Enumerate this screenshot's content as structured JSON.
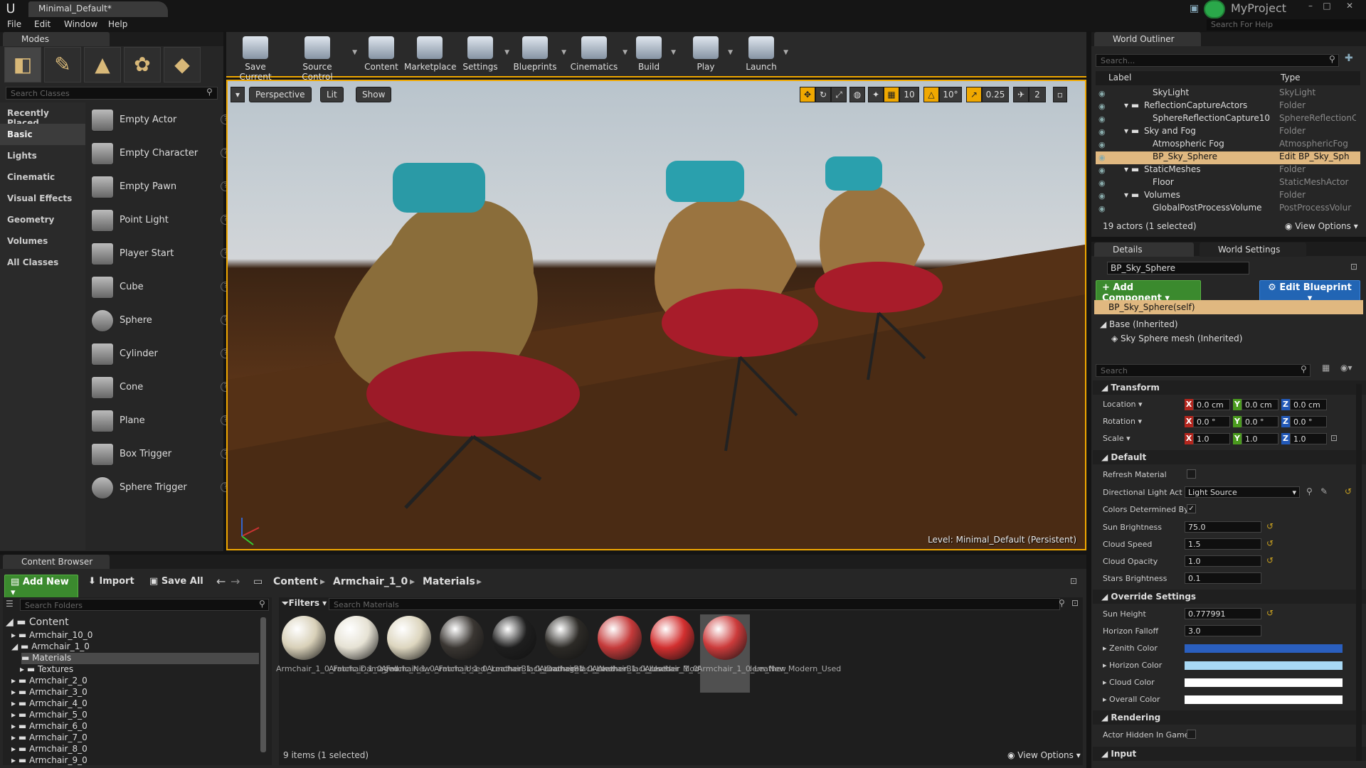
{
  "window": {
    "tab_title": "Minimal_Default",
    "project_name": "MyProject",
    "help_search_placeholder": "Search For Help"
  },
  "menu": [
    "File",
    "Edit",
    "Window",
    "Help"
  ],
  "modes": {
    "tab_label": "Modes",
    "search_placeholder": "Search Classes",
    "categories": [
      "Recently Placed",
      "Basic",
      "Lights",
      "Cinematic",
      "Visual Effects",
      "Geometry",
      "Volumes",
      "All Classes"
    ],
    "selected_category": "Basic",
    "items": [
      "Empty Actor",
      "Empty Character",
      "Empty Pawn",
      "Point Light",
      "Player Start",
      "Cube",
      "Sphere",
      "Cylinder",
      "Cone",
      "Plane",
      "Box Trigger",
      "Sphere Trigger"
    ]
  },
  "toolbar": {
    "buttons": [
      "Save Current",
      "Source Control",
      "Content",
      "Marketplace",
      "Settings",
      "Blueprints",
      "Cinematics",
      "Build",
      "Play",
      "Launch"
    ]
  },
  "viewport": {
    "perspective": "Perspective",
    "lit": "Lit",
    "show": "Show",
    "grid_snap": "10",
    "rot_snap": "10°",
    "scale_snap": "0.25",
    "camera_speed": "2",
    "level_label": "Level:",
    "level_name": "Minimal_Default (Persistent)"
  },
  "outliner": {
    "tab_label": "World Outliner",
    "search_placeholder": "Search...",
    "col_label": "Label",
    "col_type": "Type",
    "rows": [
      {
        "label": "SkyLight",
        "type": "SkyLight"
      },
      {
        "label": "ReflectionCaptureActors",
        "type": "Folder"
      },
      {
        "label": "SphereReflectionCapture10",
        "type": "SphereReflectionC"
      },
      {
        "label": "Sky and Fog",
        "type": "Folder"
      },
      {
        "label": "Atmospheric Fog",
        "type": "AtmosphericFog"
      },
      {
        "label": "BP_Sky_Sphere",
        "type": "Edit BP_Sky_Sph"
      },
      {
        "label": "StaticMeshes",
        "type": "Folder"
      },
      {
        "label": "Floor",
        "type": "StaticMeshActor"
      },
      {
        "label": "Volumes",
        "type": "Folder"
      },
      {
        "label": "GlobalPostProcessVolume",
        "type": "PostProcessVolur"
      }
    ],
    "footer": "19 actors (1 selected)",
    "view_options": "View Options"
  },
  "details": {
    "tab_label": "Details",
    "tab2_label": "World Settings",
    "actor_name": "BP_Sky_Sphere",
    "add_component": "+ Add Component",
    "edit_blueprint": "Edit Blueprint",
    "self_row": "BP_Sky_Sphere(self)",
    "base_row": "Base (Inherited)",
    "mesh_row": "Sky Sphere mesh (Inherited)",
    "search_placeholder": "Search",
    "sections": {
      "transform": "Transform",
      "default": "Default",
      "override": "Override Settings",
      "rendering": "Rendering",
      "input": "Input"
    },
    "location_label": "Location",
    "rotation_label": "Rotation",
    "scale_label": "Scale",
    "location": [
      "0.0 cm",
      "0.0 cm",
      "0.0 cm"
    ],
    "rotation": [
      "0.0 °",
      "0.0 °",
      "0.0 °"
    ],
    "scale": [
      "1.0",
      "1.0",
      "1.0"
    ],
    "axis_labels": [
      "X",
      "Y",
      "Z"
    ],
    "props": {
      "refresh_material": "Refresh Material",
      "directional_light_actor": "Directional Light Actor",
      "directional_light_value": "Light Source",
      "colors_determined_by": "Colors Determined By",
      "sun_brightness": "Sun Brightness",
      "sun_brightness_value": "75.0",
      "cloud_speed": "Cloud Speed",
      "cloud_speed_value": "1.5",
      "cloud_opacity": "Cloud Opacity",
      "cloud_opacity_value": "1.0",
      "stars_brightness": "Stars Brightness",
      "stars_brightness_value": "0.1",
      "sun_height": "Sun Height",
      "sun_height_value": "0.777991",
      "horizon_falloff": "Horizon Falloff",
      "horizon_falloff_value": "3.0",
      "zenith_color": "Zenith Color",
      "horizon_color": "Horizon Color",
      "cloud_color": "Cloud Color",
      "overall_color": "Overall Color",
      "actor_hidden": "Actor Hidden In Game"
    },
    "colors": {
      "zenith": "#2a5fbf",
      "horizon": "#a8d8f4",
      "cloud": "#ffffff",
      "overall": "#ffffff"
    }
  },
  "content_browser": {
    "tab_label": "Content Browser",
    "add_new": "Add New",
    "import": "Import",
    "save_all": "Save All",
    "breadcrumb": [
      "Content",
      "Armchair_1_0",
      "Materials"
    ],
    "folder_search_placeholder": "Search Folders",
    "filters": "Filters",
    "asset_search_placeholder": "Search Materials",
    "folders": [
      "Content",
      "Armchair_10_0",
      "Armchair_1_0",
      "Materials",
      "Textures",
      "Armchair_2_0",
      "Armchair_3_0",
      "Armchair_4_0",
      "Armchair_5_0",
      "Armchair_6_0",
      "Armchair_7_0",
      "Armchair_8_0",
      "Armchair_9_0"
    ],
    "assets": [
      {
        "name": "Armchair_1_0_Fabric_Damaged",
        "color": "#d8d0b8"
      },
      {
        "name": "Armchair_1_0_Fabric_New",
        "color": "#e6e2d4"
      },
      {
        "name": "Armchair_1_0_Fabric_Used",
        "color": "#ddd6bf"
      },
      {
        "name": "Armchair_1_0_LeatherBlack_Damaged",
        "color": "#3a3632"
      },
      {
        "name": "Armchair_1_0_LeatherBlack_New",
        "color": "#1e1e1e"
      },
      {
        "name": "Armchair_1_0_LeatherBlack_Used",
        "color": "#2c2a26"
      },
      {
        "name": "Armchair_1_0_Leather_Modern",
        "color": "#c53a3a"
      },
      {
        "name": "Armchair_1_0_Leather_Modern_New",
        "color": "#d22f2f"
      },
      {
        "name": "Armchair_1_0_Leather_Modern_Used",
        "color": "#cc3b3b"
      }
    ],
    "status": "9 items (1 selected)",
    "view_options": "View Options"
  }
}
